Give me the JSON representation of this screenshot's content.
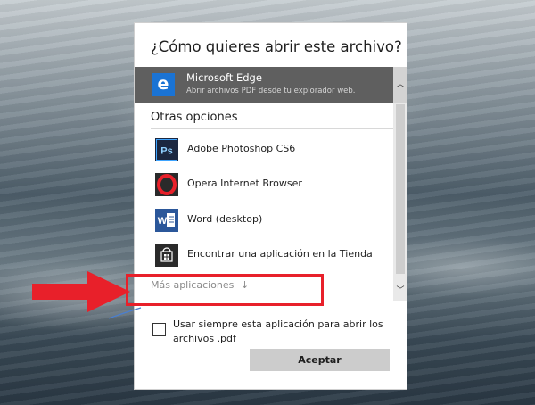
{
  "dialog": {
    "title": "¿Cómo quieres abrir este archivo?",
    "recommended": {
      "name": "Microsoft Edge",
      "description": "Abrir archivos PDF desde tu explorador web.",
      "icon": "edge-icon",
      "icon_letter": "e"
    },
    "other_options_label": "Otras opciones",
    "apps": [
      {
        "name": "Adobe Photoshop CS6",
        "icon": "photoshop-icon",
        "icon_text": "Ps"
      },
      {
        "name": "Opera Internet Browser",
        "icon": "opera-icon"
      },
      {
        "name": "Word (desktop)",
        "icon": "word-icon",
        "icon_text": "W"
      },
      {
        "name": "Encontrar una aplicación en la Tienda",
        "icon": "store-icon"
      }
    ],
    "more_apps_label": "Más aplicaciones",
    "more_apps_arrow": "↓",
    "scroll_up_glyph": "︿",
    "scroll_down_glyph": "﹀",
    "always_use_label": "Usar siempre esta aplicación para abrir los archivos .pdf",
    "always_use_checked": false,
    "accept_button": "Aceptar"
  },
  "annotation": {
    "highlight_color": "#e8202a",
    "arrow_color": "#e8202a"
  },
  "colors": {
    "edge_blue": "#1a73d4",
    "selected_row": "#5f5f5f",
    "button_gray": "#cccccc"
  }
}
